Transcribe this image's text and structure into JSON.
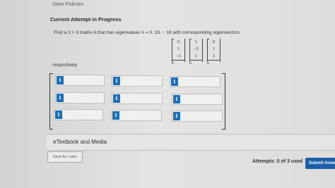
{
  "header": {
    "view_policies": "View Policies"
  },
  "attempt": {
    "title": "Current Attempt in Progress"
  },
  "question": {
    "text": "Find a 3 × 3 matrix A that has eigenvalues λ = 0, 18, − 18 with corresponding eigenvectors",
    "vectors": [
      [
        "0",
        "1",
        "−1"
      ],
      [
        "1",
        "−3",
        "1"
      ],
      [
        "0",
        "1",
        "1"
      ]
    ],
    "respectively": "respectively."
  },
  "matrix": {
    "info_icon": "i",
    "cells": [
      [
        "",
        "",
        ""
      ],
      [
        "",
        "",
        ""
      ],
      [
        "",
        "",
        ""
      ]
    ]
  },
  "etextbook": {
    "label": "eTextbook and Media"
  },
  "footer": {
    "save_later": "Save for Later",
    "attempts": "Attempts: 0 of 3 used",
    "submit": "Submit Answer"
  },
  "colors": {
    "accent": "#1c5fa8",
    "info_icon": "#1d6fb8"
  }
}
